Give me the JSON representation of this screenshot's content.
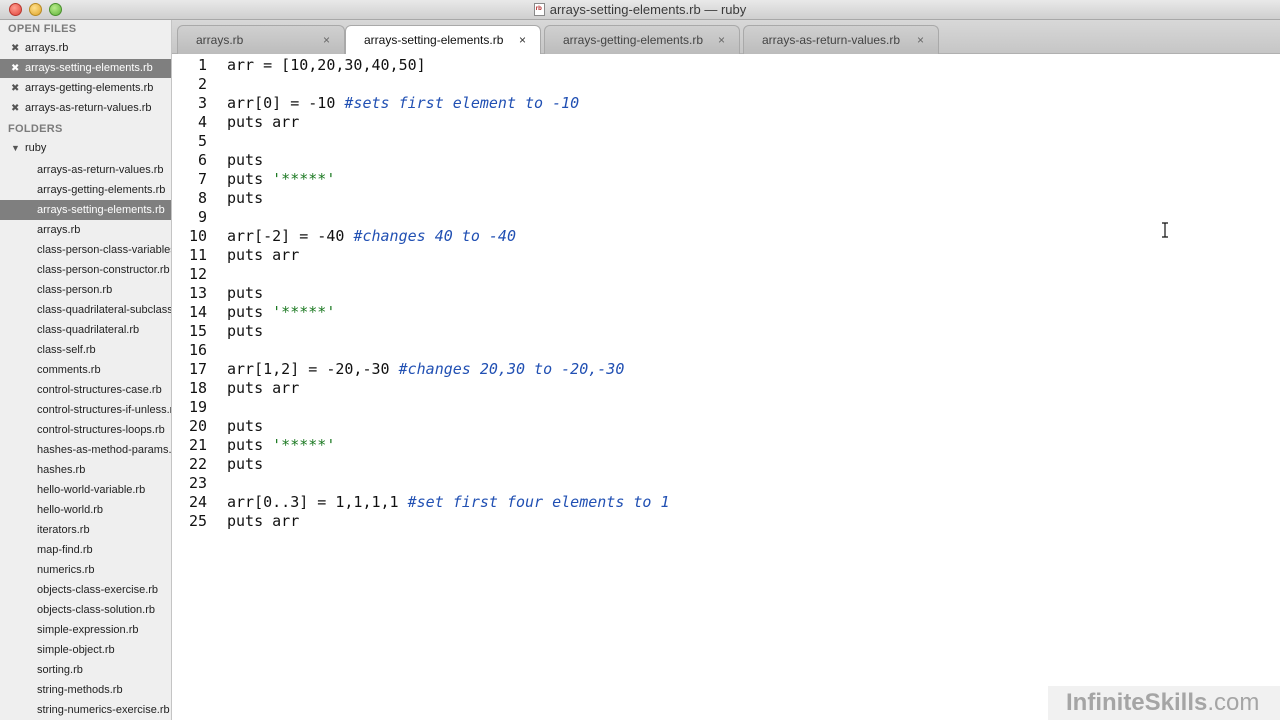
{
  "window": {
    "title": "arrays-setting-elements.rb — ruby",
    "file_icon_text": "rb"
  },
  "sidebar": {
    "open_files_header": "OPEN FILES",
    "open_files": [
      {
        "label": "arrays.rb",
        "selected": false
      },
      {
        "label": "arrays-setting-elements.rb",
        "selected": true
      },
      {
        "label": "arrays-getting-elements.rb",
        "selected": false
      },
      {
        "label": "arrays-as-return-values.rb",
        "selected": false
      }
    ],
    "folders_header": "FOLDERS",
    "folder_name": "ruby",
    "files": [
      {
        "label": "arrays-as-return-values.rb",
        "selected": false
      },
      {
        "label": "arrays-getting-elements.rb",
        "selected": false
      },
      {
        "label": "arrays-setting-elements.rb",
        "selected": true
      },
      {
        "label": "arrays.rb",
        "selected": false
      },
      {
        "label": "class-person-class-variables.rb",
        "selected": false
      },
      {
        "label": "class-person-constructor.rb",
        "selected": false
      },
      {
        "label": "class-person.rb",
        "selected": false
      },
      {
        "label": "class-quadrilateral-subclass.rb",
        "selected": false
      },
      {
        "label": "class-quadrilateral.rb",
        "selected": false
      },
      {
        "label": "class-self.rb",
        "selected": false
      },
      {
        "label": "comments.rb",
        "selected": false
      },
      {
        "label": "control-structures-case.rb",
        "selected": false
      },
      {
        "label": "control-structures-if-unless.rb",
        "selected": false
      },
      {
        "label": "control-structures-loops.rb",
        "selected": false
      },
      {
        "label": "hashes-as-method-params.rb",
        "selected": false
      },
      {
        "label": "hashes.rb",
        "selected": false
      },
      {
        "label": "hello-world-variable.rb",
        "selected": false
      },
      {
        "label": "hello-world.rb",
        "selected": false
      },
      {
        "label": "iterators.rb",
        "selected": false
      },
      {
        "label": "map-find.rb",
        "selected": false
      },
      {
        "label": "numerics.rb",
        "selected": false
      },
      {
        "label": "objects-class-exercise.rb",
        "selected": false
      },
      {
        "label": "objects-class-solution.rb",
        "selected": false
      },
      {
        "label": "simple-expression.rb",
        "selected": false
      },
      {
        "label": "simple-object.rb",
        "selected": false
      },
      {
        "label": "sorting.rb",
        "selected": false
      },
      {
        "label": "string-methods.rb",
        "selected": false
      },
      {
        "label": "string-numerics-exercise.rb",
        "selected": false
      }
    ]
  },
  "tabs": [
    {
      "label": "arrays.rb",
      "close": "×",
      "active": false
    },
    {
      "label": "arrays-setting-elements.rb",
      "close": "×",
      "active": true
    },
    {
      "label": "arrays-getting-elements.rb",
      "close": "×",
      "active": false
    },
    {
      "label": "arrays-as-return-values.rb",
      "close": "×",
      "active": false
    }
  ],
  "code": [
    {
      "n": "1",
      "code": "arr = [10,20,30,40,50]",
      "comment": ""
    },
    {
      "n": "2",
      "code": "",
      "comment": ""
    },
    {
      "n": "3",
      "code": "arr[0] = -10 ",
      "comment": "#sets first element to -10"
    },
    {
      "n": "4",
      "code": "puts arr",
      "comment": ""
    },
    {
      "n": "5",
      "code": "",
      "comment": ""
    },
    {
      "n": "6",
      "code": "puts",
      "comment": ""
    },
    {
      "n": "7",
      "code": "puts ",
      "string": "'*****'",
      "comment": ""
    },
    {
      "n": "8",
      "code": "puts",
      "comment": ""
    },
    {
      "n": "9",
      "code": "",
      "comment": ""
    },
    {
      "n": "10",
      "code": "arr[-2] = -40 ",
      "comment": "#changes 40 to -40"
    },
    {
      "n": "11",
      "code": "puts arr",
      "comment": ""
    },
    {
      "n": "12",
      "code": "",
      "comment": ""
    },
    {
      "n": "13",
      "code": "puts",
      "comment": ""
    },
    {
      "n": "14",
      "code": "puts ",
      "string": "'*****'",
      "comment": ""
    },
    {
      "n": "15",
      "code": "puts",
      "comment": ""
    },
    {
      "n": "16",
      "code": "",
      "comment": ""
    },
    {
      "n": "17",
      "code": "arr[1,2] = -20,-30 ",
      "comment": "#changes 20,30 to -20,-30"
    },
    {
      "n": "18",
      "code": "puts arr",
      "comment": ""
    },
    {
      "n": "19",
      "code": "",
      "comment": ""
    },
    {
      "n": "20",
      "code": "puts",
      "comment": ""
    },
    {
      "n": "21",
      "code": "puts ",
      "string": "'*****'",
      "comment": ""
    },
    {
      "n": "22",
      "code": "puts",
      "comment": ""
    },
    {
      "n": "23",
      "code": "",
      "comment": ""
    },
    {
      "n": "24",
      "code": "arr[0..3] = 1,1,1,1 ",
      "comment": "#set first four elements to 1"
    },
    {
      "n": "25",
      "code": "puts arr",
      "comment": ""
    }
  ],
  "watermark": {
    "brand": "InfiniteSkills",
    "suffix": ".com"
  },
  "colors": {
    "comment": "#2150b3",
    "string": "#1d7a23",
    "selection": "#7f7f7f"
  }
}
